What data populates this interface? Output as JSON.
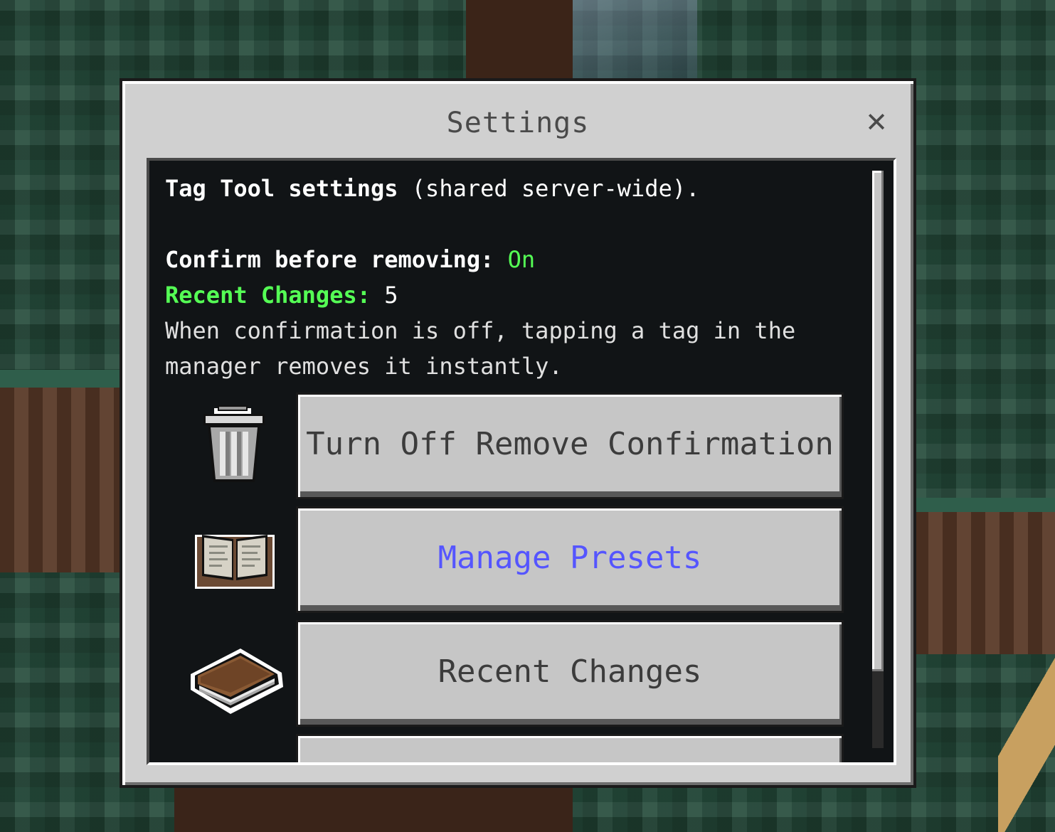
{
  "dialog": {
    "title": "Settings",
    "close_label": "✕"
  },
  "info": {
    "heading_bold": "Tag Tool settings",
    "heading_rest": " (shared server-wide).",
    "confirm_label": "Confirm before removing:",
    "confirm_value": "On",
    "recent_label": "Recent Changes:",
    "recent_value": "5",
    "description_line1": "When confirmation is off, tapping a tag in the",
    "description_line2": "manager removes it instantly."
  },
  "buttons": [
    {
      "label": "Turn Off Remove Confirmation",
      "icon": "trash-can-icon"
    },
    {
      "label": "Manage Presets",
      "icon": "open-book-icon",
      "color": "#5555ff"
    },
    {
      "label": "Recent Changes",
      "icon": "closed-book-icon"
    }
  ],
  "colors": {
    "accent_green": "#55ff55",
    "link_blue": "#5555ff",
    "panel_bg": "#111416",
    "dialog_bg": "#d0d0d0"
  }
}
